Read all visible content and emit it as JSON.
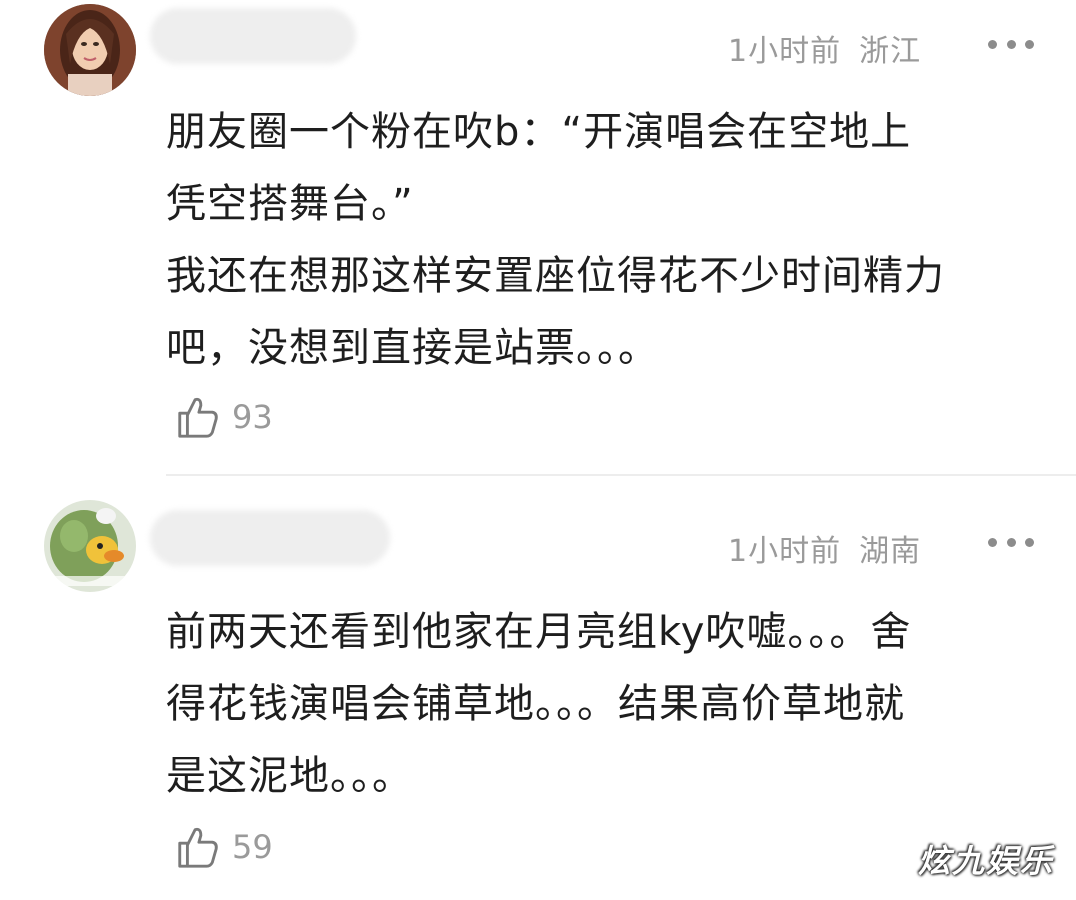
{
  "comments": [
    {
      "time": "1小时前",
      "location": "浙江",
      "lines": [
        "朋友圈一个粉在吹b：“开演唱会在空地上",
        "凭空搭舞台。”",
        "我还在想那这样安置座位得花不少时间精力",
        "吧，没想到直接是站票。。。"
      ],
      "likes": "93",
      "avatar_icon": "woman-portrait-avatar"
    },
    {
      "time": "1小时前",
      "location": "湖南",
      "lines": [
        "前两天还看到他家在月亮组ky吹嘘。。。舍",
        "得花钱演唱会铺草地。。。结果高价草地就",
        "是这泥地。。。"
      ],
      "likes": "59",
      "avatar_icon": "cartoon-duck-avatar"
    }
  ],
  "watermark": "炫九娱乐",
  "colors": {
    "meta_text": "#9a9a9a",
    "body_text": "#1e1e1e",
    "divider": "#ededed"
  }
}
